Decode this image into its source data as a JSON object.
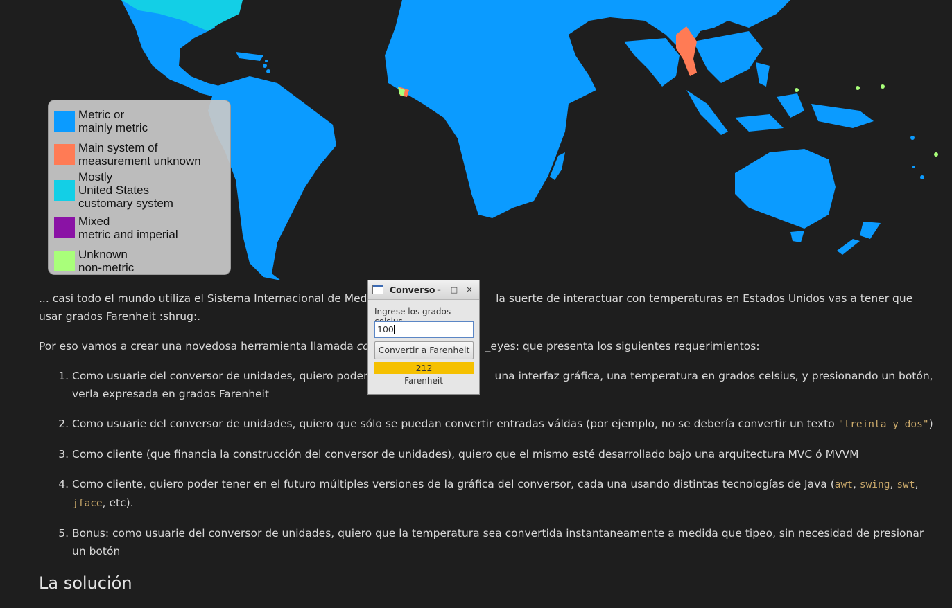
{
  "map": {
    "colors": {
      "metric": "#0b9bff",
      "unknown_system": "#ff7b55",
      "us_customary": "#13cfe6",
      "mixed": "#8a12a5",
      "unknown_non_metric": "#a9ff7a"
    },
    "legend": [
      {
        "label": "Metric or\nmainly metric",
        "color": "#0b9bff"
      },
      {
        "label": "Main system of\nmeasurement unknown",
        "color": "#ff7b55"
      },
      {
        "label": "Mostly\nUnited States\ncustomary system",
        "color": "#13cfe6"
      },
      {
        "label": "Mixed\nmetric and imperial",
        "color": "#8a12a5"
      },
      {
        "label": "Unknown\nnon-metric",
        "color": "#a9ff7a"
      }
    ]
  },
  "dialog": {
    "title": "Converso",
    "minimize": "–",
    "maximize": "□",
    "close": "✕",
    "prompt": "Ingrese los grados celsius",
    "input_value": "100",
    "button_label": "Convertir a Farenheit",
    "result": "212",
    "unit_label": "Farenheit",
    "result_color": "#f5c000"
  },
  "content": {
    "p1a": "... casi todo el mundo utiliza el Sistema Internacional de Medida",
    "p1b": "la suerte de interactuar con temperaturas en Estados Unidos vas a tener que usar grados Farenheit :shrug:.",
    "p2a": "Por eso vamos a crear una novedosa herramienta llamada ",
    "p2_em": "conv",
    "p2b": "_eyes: que presenta los siguientes requerimientos:",
    "items": [
      {
        "a": "Como usuarie del conversor de unidades, quiero poder in",
        "b": "una interfaz gráfica, una temperatura en grados celsius, y presionando un botón, verla expresada en grados Farenheit"
      },
      {
        "a": "Como usuarie del conversor de unidades, quiero que sólo se puedan convertir entradas váldas (por ejemplo, no se debería convertir un texto ",
        "code": "\"treinta y dos\"",
        "b": ")"
      },
      {
        "a": "Como cliente (que financia la construcción del conversor de unidades), quiero que el mismo esté desarrollado bajo una arquitectura MVC ó MVVM"
      },
      {
        "a": "Como cliente, quiero poder tener en el futuro múltiples versiones de la gráfica del conversor, cada una usando distintas tecnologías de Java (",
        "code1": "awt",
        "sep1": ", ",
        "code2": "swing",
        "sep2": ", ",
        "code3": "swt",
        "sep3": ", ",
        "code4": "jface",
        "b": ", etc)."
      },
      {
        "a": "Bonus: como usuarie del conversor de unidades, quiero que la temperatura sea convertida instantaneamente a medida que tipeo, sin necesidad de presionar un botón"
      }
    ],
    "heading": "La solución"
  }
}
